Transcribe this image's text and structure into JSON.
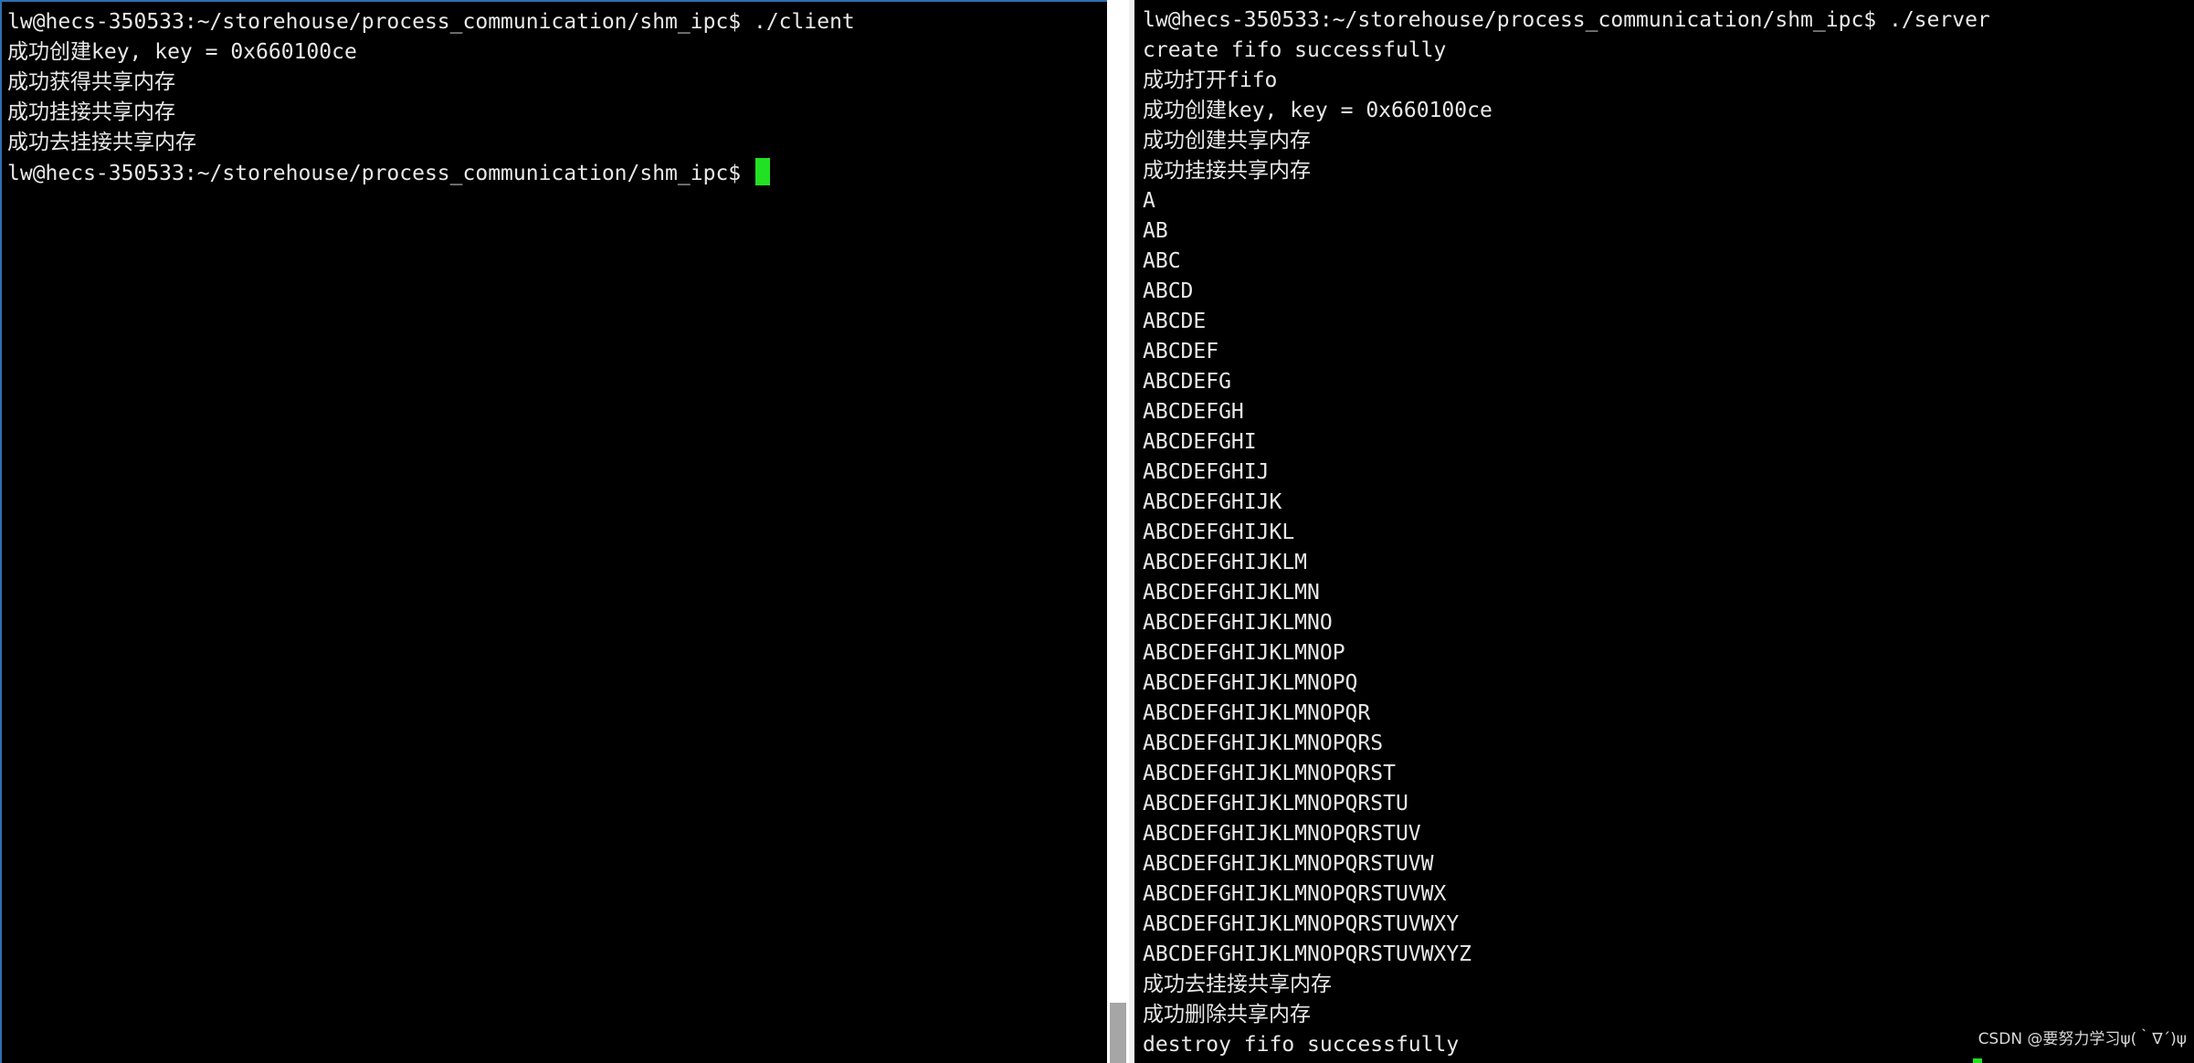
{
  "client_pane": {
    "lines": [
      "lw@hecs-350533:~/storehouse/process_communication/shm_ipc$ ./client",
      "成功创建key, key = 0x660100ce",
      "成功获得共享内存",
      "成功挂接共享内存",
      "成功去挂接共享内存"
    ],
    "prompt": "lw@hecs-350533:~/storehouse/process_communication/shm_ipc$ "
  },
  "server_pane": {
    "lines": [
      "lw@hecs-350533:~/storehouse/process_communication/shm_ipc$ ./server",
      "create fifo successfully",
      "成功打开fifo",
      "成功创建key, key = 0x660100ce",
      "成功创建共享内存",
      "成功挂接共享内存",
      "A",
      "AB",
      "ABC",
      "ABCD",
      "ABCDE",
      "ABCDEF",
      "ABCDEFG",
      "ABCDEFGH",
      "ABCDEFGHI",
      "ABCDEFGHIJ",
      "ABCDEFGHIJK",
      "ABCDEFGHIJKL",
      "ABCDEFGHIJKLM",
      "ABCDEFGHIJKLMN",
      "ABCDEFGHIJKLMNO",
      "ABCDEFGHIJKLMNOP",
      "ABCDEFGHIJKLMNOPQ",
      "ABCDEFGHIJKLMNOPQR",
      "ABCDEFGHIJKLMNOPQRS",
      "ABCDEFGHIJKLMNOPQRST",
      "ABCDEFGHIJKLMNOPQRSTU",
      "ABCDEFGHIJKLMNOPQRSTUV",
      "ABCDEFGHIJKLMNOPQRSTUVW",
      "ABCDEFGHIJKLMNOPQRSTUVWX",
      "ABCDEFGHIJKLMNOPQRSTUVWXY",
      "ABCDEFGHIJKLMNOPQRSTUVWXYZ",
      "成功去挂接共享内存",
      "成功删除共享内存",
      "destroy fifo successfully"
    ]
  },
  "watermark": "CSDN @要努力学习ψ(｀∇´)ψ",
  "colors": {
    "background": "#000000",
    "text": "#e8e8e8",
    "cursor": "#22e022",
    "pane_border": "#2f6fb3"
  }
}
